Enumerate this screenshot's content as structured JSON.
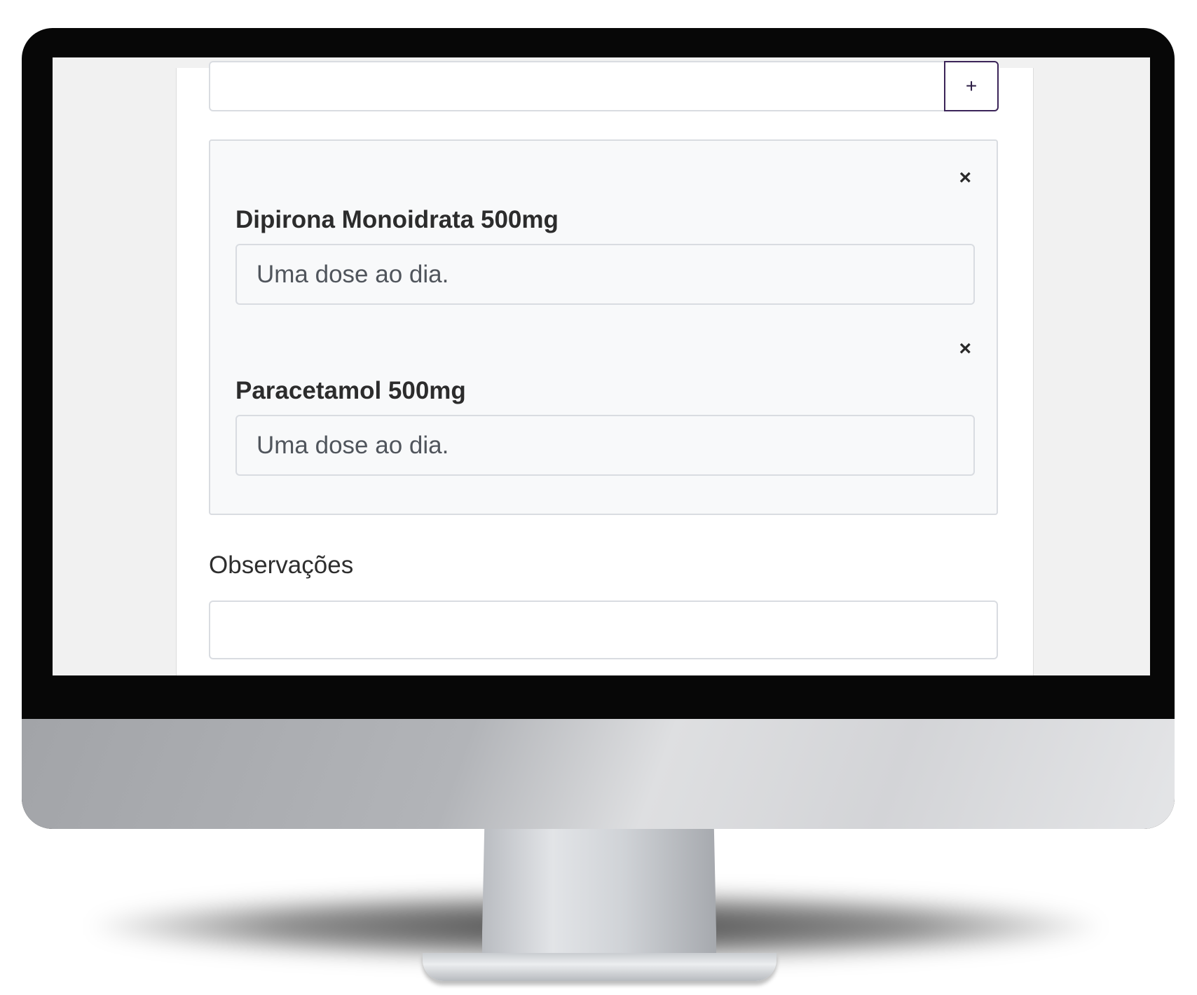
{
  "form": {
    "add_button_label": "+",
    "medications": [
      {
        "name": "Dipirona Monoidrata 500mg",
        "dosage": "Uma dose ao dia.",
        "remove_icon": "×"
      },
      {
        "name": "Paracetamol 500mg",
        "dosage": "Uma dose ao dia.",
        "remove_icon": "×"
      }
    ],
    "observations_label": "Observações",
    "observations_value": ""
  },
  "colors": {
    "accent": "#3b2458",
    "panel_bg": "#f8f9fa",
    "border": "#d9dce1",
    "bezel": "#070707"
  }
}
